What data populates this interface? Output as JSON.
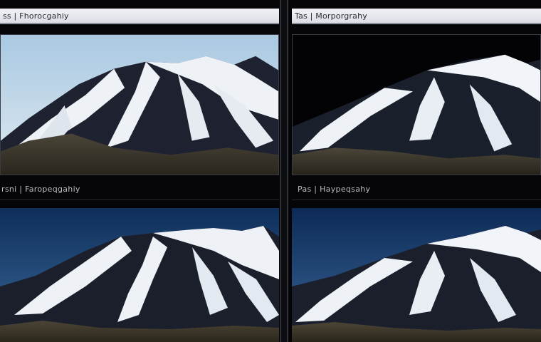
{
  "panels": [
    {
      "label": "ss | Fhorocgahiy",
      "sky": "light-blue"
    },
    {
      "label": "Tas | Morporgrahy",
      "sky": "black"
    },
    {
      "label": "rsni | Faropeqgahiy",
      "sky": "deep-blue"
    },
    {
      "label": "Pas | Haypeqsahy",
      "sky": "deep-blue"
    }
  ],
  "colors": {
    "background": "#050507",
    "titlebar": "#e8e9ee",
    "snow": "#f4f6fa",
    "rock": "#1a1d26"
  }
}
